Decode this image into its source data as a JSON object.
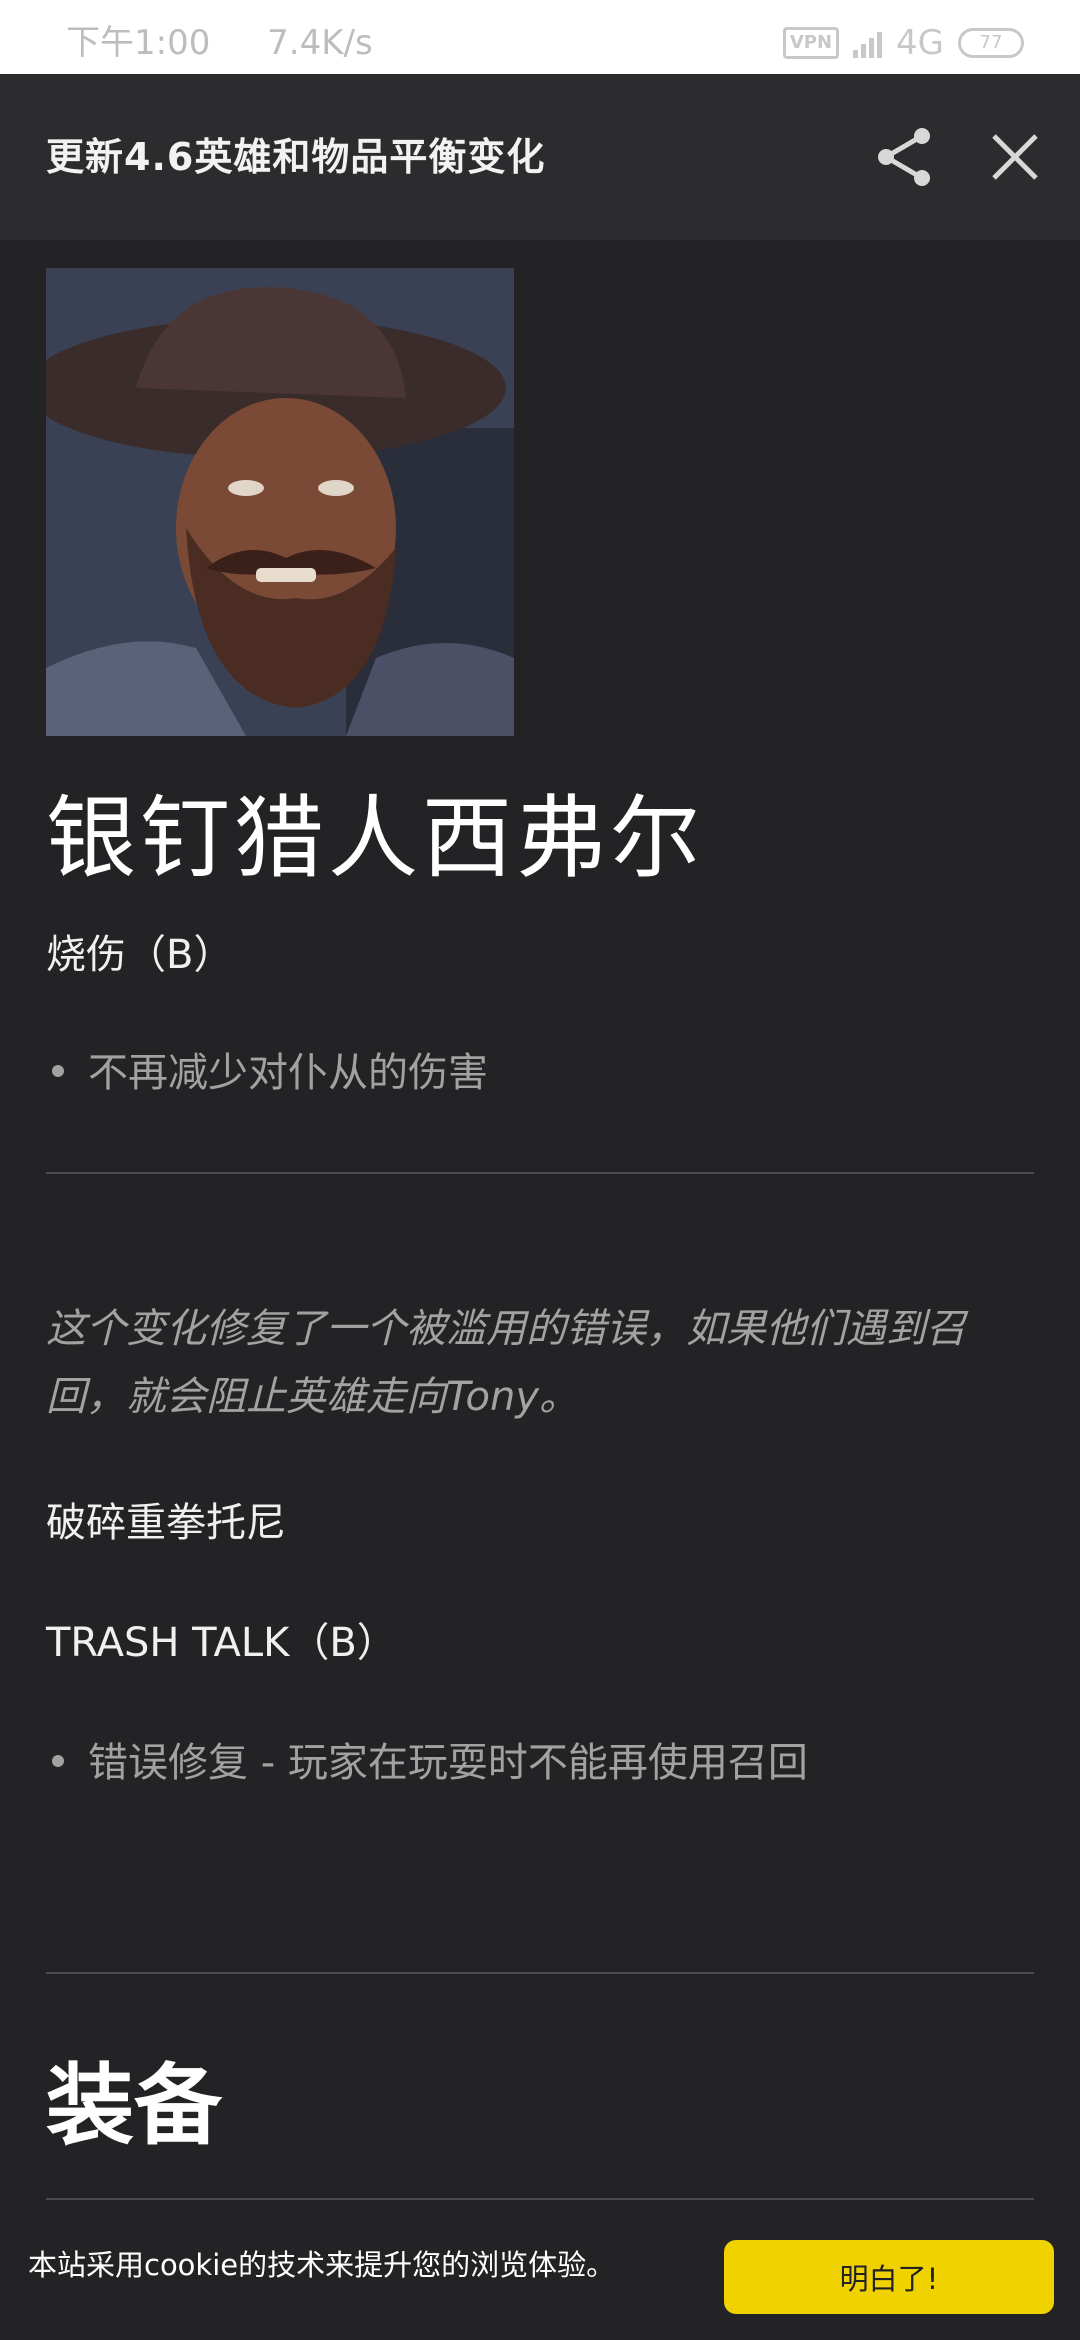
{
  "status_bar": {
    "time": "下午1:00",
    "speed": "7.4K/s",
    "vpn": "VPN",
    "network": "4G",
    "battery": "77"
  },
  "header": {
    "title": "更新4.6英雄和物品平衡变化"
  },
  "hero": {
    "name": "银钉猎人西弗尔",
    "ability_1": "烧伤（B）",
    "bullet_1": "不再减少对仆从的伤害"
  },
  "note": "这个变化修复了一个被滥用的错误，如果他们遇到召回，就会阻止英雄走向Tony。",
  "hero2": {
    "name": "破碎重拳托尼",
    "ability_1": "TRASH TALK（B）",
    "bullet_1": "错误修复 - 玩家在玩耍时不能再使用召回"
  },
  "section": {
    "title": "装备"
  },
  "cookie": {
    "message": "本站采用cookie的技术来提升您的浏览体验。",
    "button": "明白了!"
  }
}
